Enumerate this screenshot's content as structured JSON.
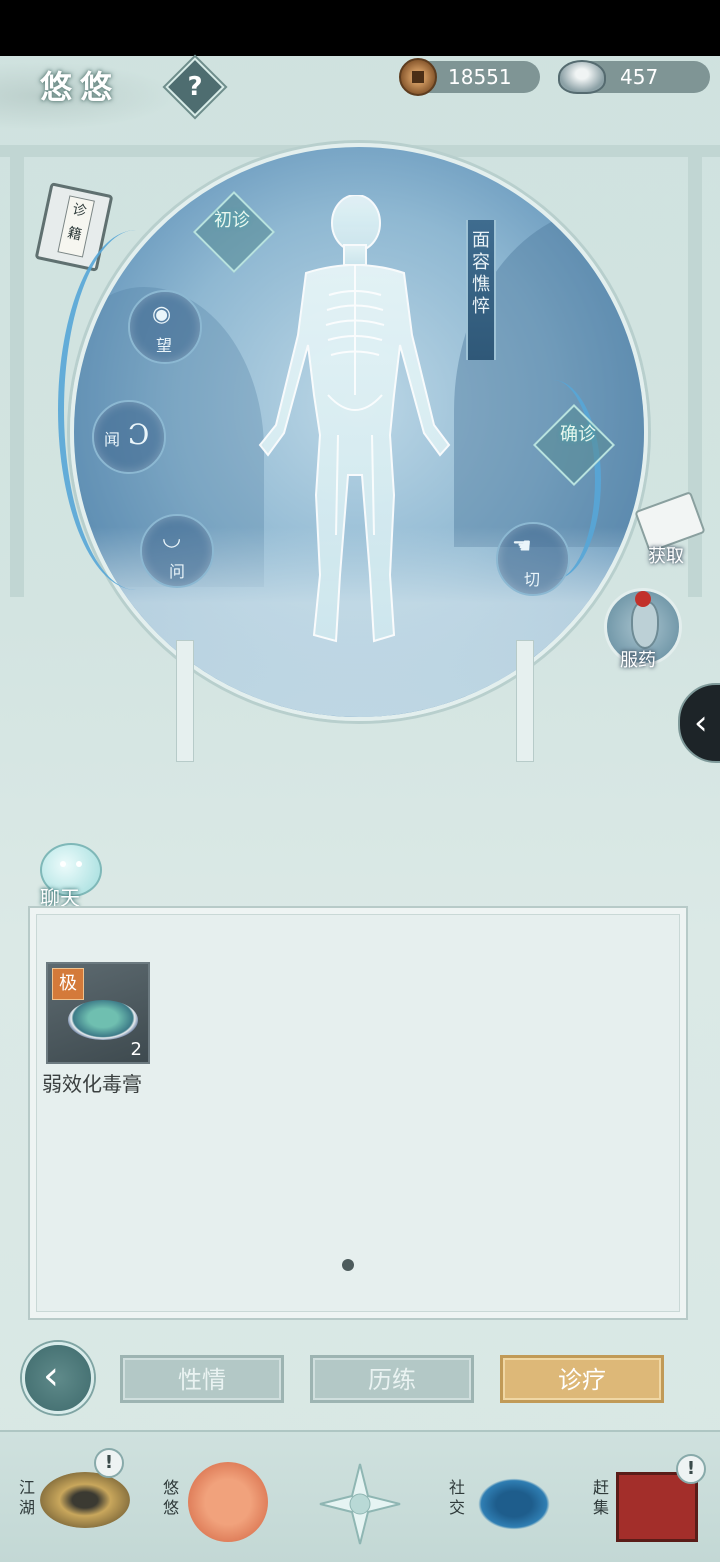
{
  "header": {
    "character_name": "悠悠",
    "help_label": "?",
    "copper_amount": "18551",
    "silver_amount": "457",
    "diagnosis_book_label": "诊籍"
  },
  "diagnosis": {
    "initial_label": "初诊",
    "confirm_label": "确诊",
    "symptom_label": "面容憔悴",
    "methods": [
      {
        "label": "望",
        "icon": "eye-icon"
      },
      {
        "label": "闻",
        "icon": "ear-icon"
      },
      {
        "label": "问",
        "icon": "lips-icon"
      },
      {
        "label": "切",
        "icon": "hand-icon"
      }
    ]
  },
  "side": {
    "obtain_label": "获取",
    "medicine_label": "服药",
    "collapse_label": "‹"
  },
  "chat": {
    "label": "聊天"
  },
  "inventory": {
    "items": [
      {
        "name": "弱效化毒膏",
        "grade": "极",
        "count": "2"
      }
    ]
  },
  "tabs": [
    {
      "label": "性情",
      "active": false
    },
    {
      "label": "历练",
      "active": false
    },
    {
      "label": "诊疗",
      "active": true
    }
  ],
  "bottom_nav": [
    {
      "label": "江湖",
      "alert": "!"
    },
    {
      "label": "悠悠",
      "alert": ""
    },
    {
      "label": "",
      "alert": ""
    },
    {
      "label": "社交",
      "alert": ""
    },
    {
      "label": "赶集",
      "alert": "!"
    }
  ],
  "colors": {
    "active_tab": "#ddb878",
    "inactive_tab": "#b3c8c6",
    "circle_blue": "#3e76a3",
    "accent_arc": "#57a7d8"
  }
}
